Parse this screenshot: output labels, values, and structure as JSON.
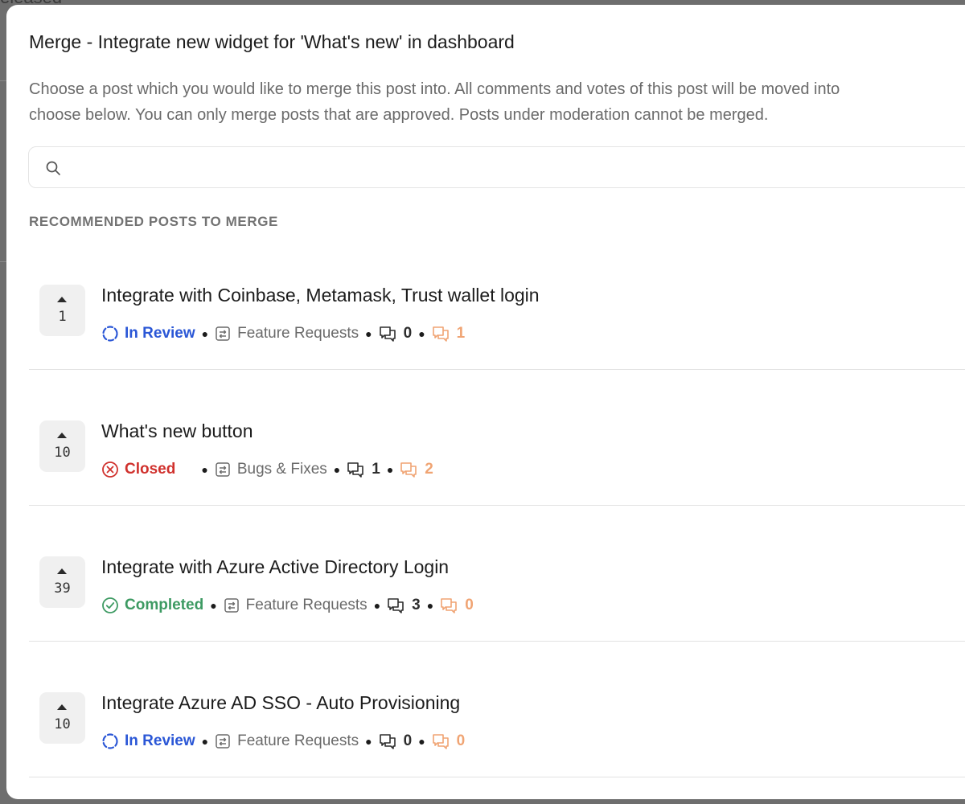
{
  "backdrop": {
    "partial_text": "eleased"
  },
  "modal": {
    "title": "Merge - Integrate new widget for 'What's new' in dashboard",
    "description_line1": "Choose a post which you would like to merge this post into. All comments and votes of this post will be moved into",
    "description_line2": "choose below. You can only merge posts that are approved. Posts under moderation cannot be merged.",
    "search": {
      "placeholder": "",
      "value": "",
      "icon": "search-icon"
    },
    "section_label": "RECOMMENDED POSTS TO MERGE",
    "posts": [
      {
        "votes": "1",
        "title": "Integrate with Coinbase, Metamask, Trust wallet login",
        "status": "In Review",
        "status_color": "#2b57d6",
        "status_icon": "in-review-icon",
        "board": "Feature Requests",
        "comments": "0",
        "internal_comments": "1"
      },
      {
        "votes": "10",
        "title": "What's new button",
        "status": "Closed",
        "status_color": "#d0312d",
        "status_icon": "closed-icon",
        "board": "Bugs & Fixes",
        "comments": "1",
        "internal_comments": "2"
      },
      {
        "votes": "39",
        "title": "Integrate with Azure Active Directory Login",
        "status": "Completed",
        "status_color": "#3d9a62",
        "status_icon": "completed-icon",
        "board": "Feature Requests",
        "comments": "3",
        "internal_comments": "0"
      },
      {
        "votes": "10",
        "title": "Integrate Azure AD SSO - Auto Provisioning",
        "status": "In Review",
        "status_color": "#2b57d6",
        "status_icon": "in-review-icon",
        "board": "Feature Requests",
        "comments": "0",
        "internal_comments": "0"
      }
    ]
  },
  "colors": {
    "comment_count": "#2e2e2e",
    "internal_comment_count": "#f0a473",
    "board_text": "#6a6a6a"
  }
}
